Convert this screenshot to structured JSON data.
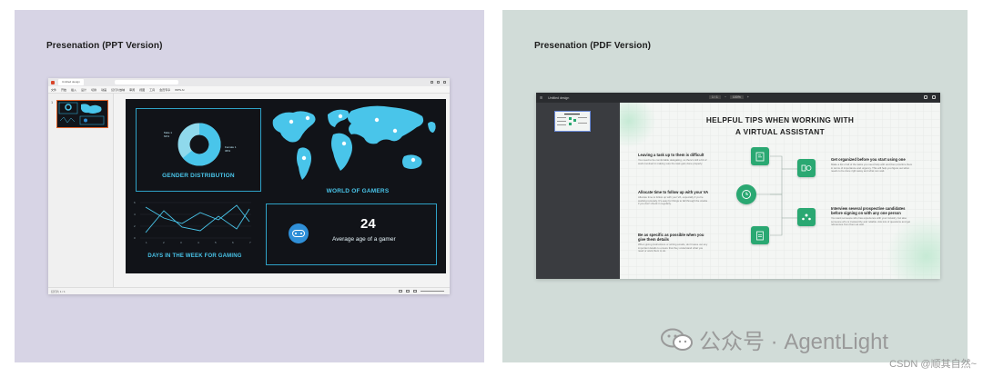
{
  "ppt_panel": {
    "title": "Presenation (PPT Version)",
    "window": {
      "tab_label": "Untitled design",
      "menu_items": [
        "文件",
        "开始",
        "插入",
        "设计",
        "切换",
        "动画",
        "幻灯片放映",
        "审阅",
        "视图",
        "工具",
        "会员专享",
        "WPS AI"
      ],
      "slide_number": "1",
      "status_left": "幻灯片 1 / 1"
    },
    "slide": {
      "gender_label": "GENDER DISTRIBUTION",
      "gender_note_left": "Male 1\n64%",
      "gender_note_right": "Female 1\n36%",
      "gender_values": [
        64,
        36
      ],
      "world_label": "WORLD OF GAMERS",
      "days_label": "DAYS IN THE WEEK FOR GAMING",
      "days_x_ticks": [
        "1",
        "2",
        "3",
        "4",
        "5",
        "6",
        "7"
      ],
      "days_y_ticks": [
        "6",
        "4",
        "2",
        "0"
      ],
      "age_value": "24",
      "age_caption": "Average age of a gamer"
    }
  },
  "pdf_panel": {
    "title": "Presenation (PDF Version)",
    "window": {
      "file_name": "Untitled design",
      "page_info": "1 / 1",
      "zoom": "100%"
    },
    "page": {
      "title_line1": "HELPFUL TIPS WHEN WORKING WITH",
      "title_line2": "A VIRTUAL ASSISTANT",
      "tips_left": [
        {
          "head": "Leaving a task up to them is difficult",
          "body": "You need to be comfortable delegating, so there's still a bit of work involved in making sure the task gets done properly."
        },
        {
          "head": "Allocate time to follow up with your VA",
          "body": "Allocate time to follow up with your VA, especially if you're working remotely. It's easy for things to fall through the cracks if you don't check in regularly."
        },
        {
          "head": "Be as specific as possible when you give them details",
          "body": "When giving instructions or writing emails, don't leave out any important details to ensure that they understand what you need or want them to do."
        }
      ],
      "tips_right": [
        {
          "head": "Get organized before you start using one",
          "body": "Make a list of all of the tasks you need help with and then prioritize them in terms of importance and urgency. This will help you figure out what needs to be done right away and what can wait."
        },
        {
          "head": "Interview several prospective candidates before signing on with any one person",
          "body": "You want someone who has experience with your industry, but also someone who is trustworthy and reliable. Ask lots of questions and get references from them as well."
        }
      ]
    }
  },
  "watermark": {
    "account": "公众号 · AgentLight",
    "csdn": "CSDN @顺其自然~"
  },
  "colors": {
    "ppt_bg": "#d7d4e5",
    "pdf_bg": "#d1dcd8",
    "accent_cyan": "#49c5ea",
    "accent_green": "#2aa872"
  }
}
